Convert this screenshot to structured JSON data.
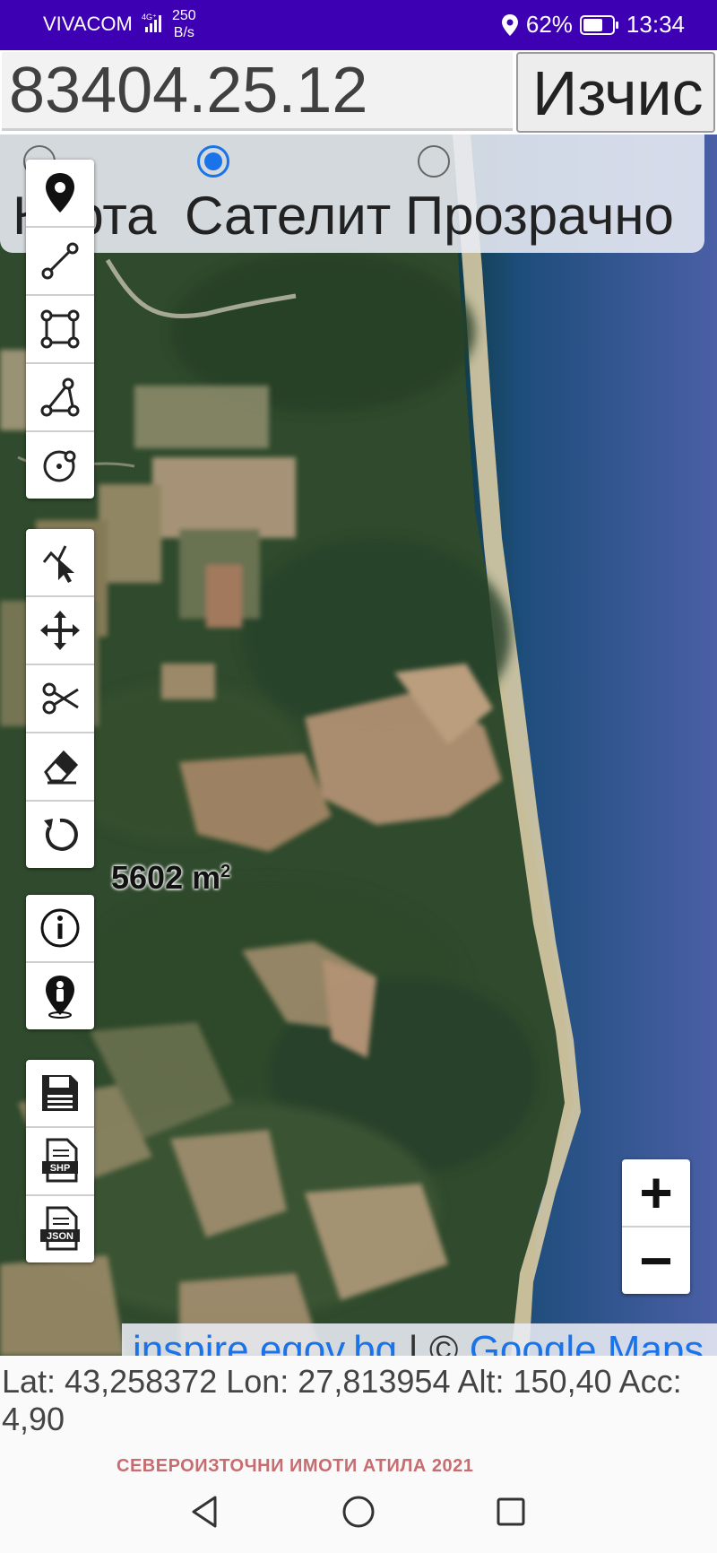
{
  "status_bar": {
    "carrier": "VIVACOM",
    "network_badge": "4G⁺",
    "net_speed_value": "250",
    "net_speed_unit": "B/s",
    "battery": "62%",
    "time": "13:34"
  },
  "search": {
    "value": "83404.25.12",
    "calc_label": "Изчис"
  },
  "map_types": [
    {
      "label": "Карта",
      "selected": false
    },
    {
      "label": "Сателит",
      "selected": true
    },
    {
      "label": "Прозрачно",
      "selected": false
    }
  ],
  "tool_groups": [
    [
      "location-pin-icon",
      "line-icon",
      "rectangle-icon",
      "angle-measure-icon",
      "circle-icon"
    ],
    [
      "select-pointer-icon",
      "move-icon",
      "scissors-icon",
      "eraser-icon",
      "undo-icon"
    ],
    [
      "info-icon",
      "person-location-icon"
    ],
    [
      "save-icon",
      "shp-file-icon",
      "json-file-icon"
    ]
  ],
  "map": {
    "area_value": "5602 m",
    "area_exponent": "2"
  },
  "zoom": {
    "in_label": "+",
    "out_label": "−"
  },
  "attribution": {
    "source1": "inspire.egov.bg",
    "separator": " | © ",
    "source2": "Google Maps"
  },
  "location_readout": "Lat: 43,258372 Lon: 27,813954 Alt: 150,40 Acc: 4,90",
  "footer_brand": "СЕВЕРОИЗТОЧНИ ИМОТИ АТИЛА 2021",
  "colors": {
    "status_bar": "#3d00b3",
    "accent": "#1a73e8",
    "brand_text": "#c76d70"
  }
}
